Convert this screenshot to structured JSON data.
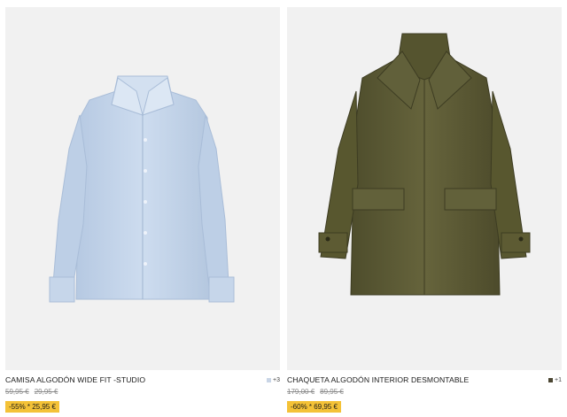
{
  "products": [
    {
      "title": "CAMISA ALGODÓN WIDE FIT -STUDIO",
      "original_price": "59,95 €",
      "previous_price": "29,95 €",
      "sale_label": "-55% * 25,95 €",
      "more_colors": "+3",
      "swatch_color": "#c9d5e6",
      "image_icon": "shirt-image"
    },
    {
      "title": "CHAQUETA ALGODÓN INTERIOR DESMONTABLE",
      "original_price": "179,00 €",
      "previous_price": "89,95 €",
      "sale_label": "-60% * 69,95 €",
      "more_colors": "+1",
      "swatch_color": "#4b4632",
      "image_icon": "jacket-image"
    }
  ],
  "colors": {
    "badge": "#f4c237",
    "image_bg": "#f1f1f1",
    "shirt": "#c3d4e9",
    "jacket": "#5b5a35"
  }
}
